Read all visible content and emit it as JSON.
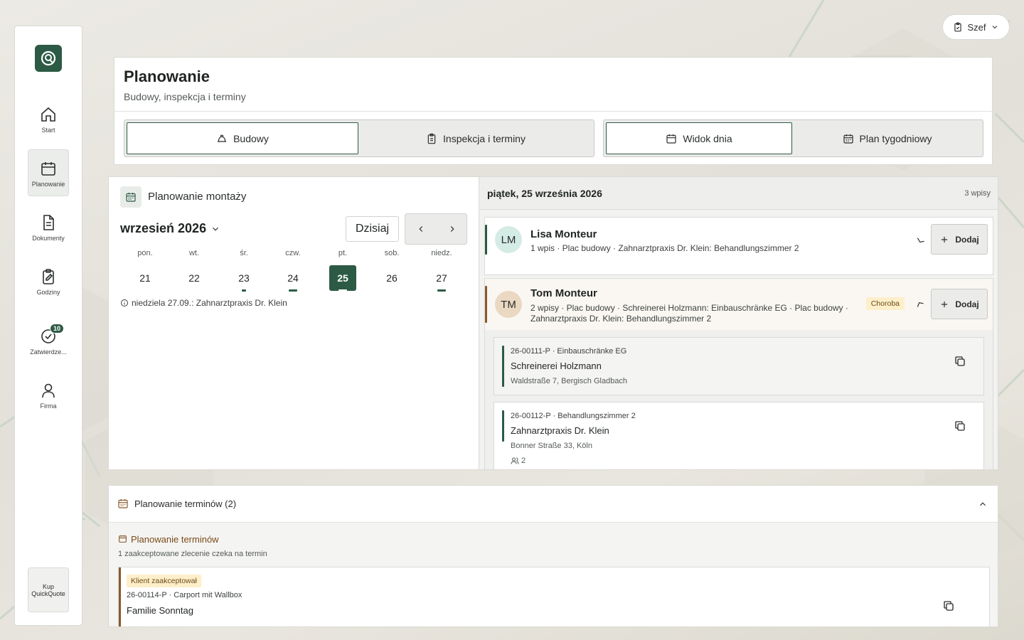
{
  "sidebar": {
    "items": [
      {
        "label": "Start",
        "icon": "home-icon"
      },
      {
        "label": "Planowanie",
        "icon": "calendar-icon"
      },
      {
        "label": "Dokumenty",
        "icon": "document-icon"
      },
      {
        "label": "Godziny",
        "icon": "clipboard-edit-icon"
      },
      {
        "label": "Zatwierdze...",
        "icon": "check-circle-icon",
        "badge": "10"
      },
      {
        "label": "Firma",
        "icon": "user-icon"
      }
    ],
    "buy_label_line1": "Kup",
    "buy_label_line2": "QuickQuote"
  },
  "user": {
    "role": "Szef"
  },
  "header": {
    "title": "Planowanie",
    "subtitle": "Budowy, inspekcja i terminy",
    "tabs_left": [
      {
        "label": "Budowy",
        "active": true
      },
      {
        "label": "Inspekcja i terminy",
        "active": false
      }
    ],
    "tabs_right": [
      {
        "label": "Widok dnia",
        "active": true
      },
      {
        "label": "Plan tygodniowy",
        "active": false
      }
    ]
  },
  "calendar": {
    "title": "Planowanie montaży",
    "month": "wrzesień 2026",
    "today_label": "Dzisiaj",
    "weekdays": [
      "pon.",
      "wt.",
      "śr.",
      "czw.",
      "pt.",
      "sob.",
      "niedz."
    ],
    "days": [
      "21",
      "22",
      "23",
      "24",
      "25",
      "26",
      "27"
    ],
    "selected_day": "25",
    "note": "niedziela 27.09.: Zahnarztpraxis Dr. Klein"
  },
  "day_view": {
    "title": "piątek, 25 września 2026",
    "count": "3 wpisy",
    "add_label": "Dodaj",
    "people": [
      {
        "initials": "LM",
        "name": "Lisa Monteur",
        "info": "1 wpis · Plac budowy · Zahnarztpraxis Dr. Klein: Behandlungszimmer 2"
      },
      {
        "initials": "TM",
        "name": "Tom Monteur",
        "info_line1": "2 wpisy · Plac budowy · Schreinerei Holzmann: Einbauschränke EG · Plac budowy ·",
        "info_line2": "Zahnarztpraxis Dr. Klein: Behandlungszimmer 2",
        "status": "Choroba"
      }
    ],
    "tasks": [
      {
        "code": "26-00111-P · Einbauschränke EG",
        "name": "Schreinerei Holzmann",
        "address": "Waldstraße 7, Bergisch Gladbach"
      },
      {
        "code": "26-00112-P · Behandlungszimmer 2",
        "name": "Zahnarztpraxis Dr. Klein",
        "address": "Bonner Straße 33, Köln",
        "people_count": "2"
      }
    ]
  },
  "appointments": {
    "title": "Planowanie terminów (2)",
    "section_title": "Planowanie terminów",
    "section_desc": "1 zaakceptowane zlecenie czeka na termin",
    "card": {
      "status": "Klient zaakceptował",
      "code": "26-00114-P · Carport mit Wallbox",
      "name": "Familie Sonntag"
    }
  },
  "colors": {
    "brand": "#2c5a45",
    "warning_bg": "#fdefc9",
    "accent_brown": "#8a5a2a"
  }
}
